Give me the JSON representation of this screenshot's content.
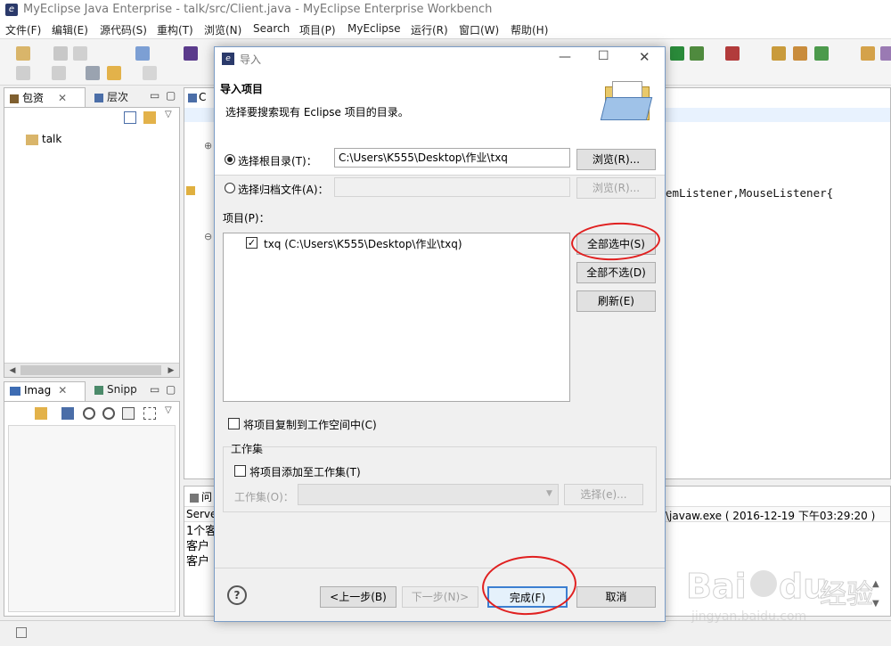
{
  "window": {
    "title": "MyEclipse Java Enterprise  -  talk/src/Client.java  -  MyEclipse Enterprise Workbench"
  },
  "menu": [
    "文件(F)",
    "编辑(E)",
    "源代码(S)",
    "重构(T)",
    "浏览(N)",
    "Search",
    "项目(P)",
    "MyEclipse",
    "运行(R)",
    "窗口(W)",
    "帮助(H)"
  ],
  "left_top_panel": {
    "tabs": [
      "包资",
      "层次"
    ],
    "tree_item": "talk"
  },
  "left_bottom_panel": {
    "tabs": [
      "Imag",
      "Snipp"
    ]
  },
  "editor": {
    "tab_label": "C",
    "code_fragment": "emListener,MouseListener{"
  },
  "console": {
    "tab_label": "问",
    "header_left": "Serve",
    "header_right": "\\javaw.exe ( 2016-12-19 下午03:29:20 )",
    "lines": [
      "1个客",
      "客户",
      "客户"
    ]
  },
  "dialog": {
    "title": "导入",
    "header_title": "导入项目",
    "header_desc": "选择要搜索现有 Eclipse 项目的目录。",
    "radio_root_label": "选择根目录(T)：",
    "root_path_value": "C:\\Users\\K555\\Desktop\\作业\\txq",
    "browse_label": "浏览(R)...",
    "radio_archive_label": "选择归档文件(A)：",
    "archive_value": "",
    "browse2_label": "浏览(R)...",
    "projects_label": "项目(P)：",
    "project_item": "txq (C:\\Users\\K555\\Desktop\\作业\\txq)",
    "select_all_label": "全部选中(S)",
    "deselect_all_label": "全部不选(D)",
    "refresh_label": "刷新(E)",
    "copy_label": "将项目复制到工作空间中(C)",
    "working_set_group": "工作集",
    "add_ws_label": "将项目添加至工作集(T)",
    "ws_label": "工作集(O)：",
    "ws_select_label": "选择(e)...",
    "help_symbol": "?",
    "back_label": "<上一步(B)",
    "next_label": "下一步(N)>",
    "finish_label": "完成(F)",
    "cancel_label": "取消"
  },
  "watermark": {
    "brand": "Bai",
    "brand_suffix": "du",
    "cn": "经验",
    "url": "jingyan.baidu.com"
  },
  "colors": {
    "annotation_red": "#e02020",
    "dialog_border": "#7a9cc6",
    "link_blue": "#1a4f9a"
  }
}
